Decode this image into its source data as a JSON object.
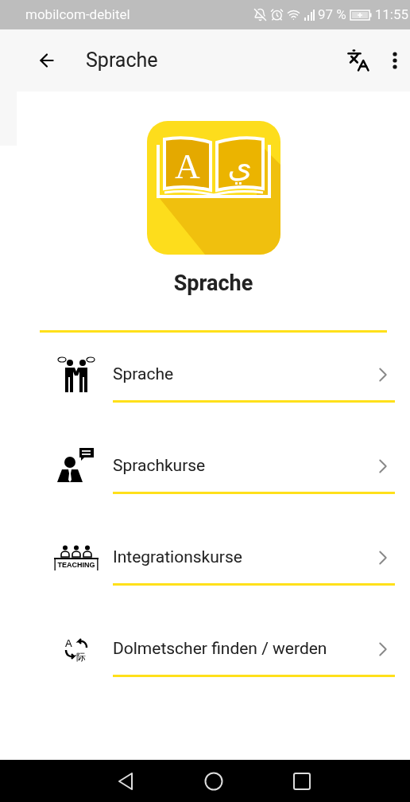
{
  "status_bar": {
    "carrier": "mobilcom-debitel",
    "battery": "97 %",
    "time": "11:55"
  },
  "app_bar": {
    "title": "Sprache"
  },
  "header": {
    "icon_letters": [
      "A",
      "ي"
    ],
    "title": "Sprache"
  },
  "menu": [
    {
      "label": "Sprache",
      "kind": "handshake"
    },
    {
      "label": "Sprachkurse",
      "kind": "speaker"
    },
    {
      "label": "Integrationskurse",
      "kind": "teaching",
      "icon_text": [
        "TEACHING"
      ]
    },
    {
      "label": "Dolmetscher finden / werden",
      "kind": "translate",
      "icon_text": [
        "A",
        "际"
      ]
    }
  ]
}
